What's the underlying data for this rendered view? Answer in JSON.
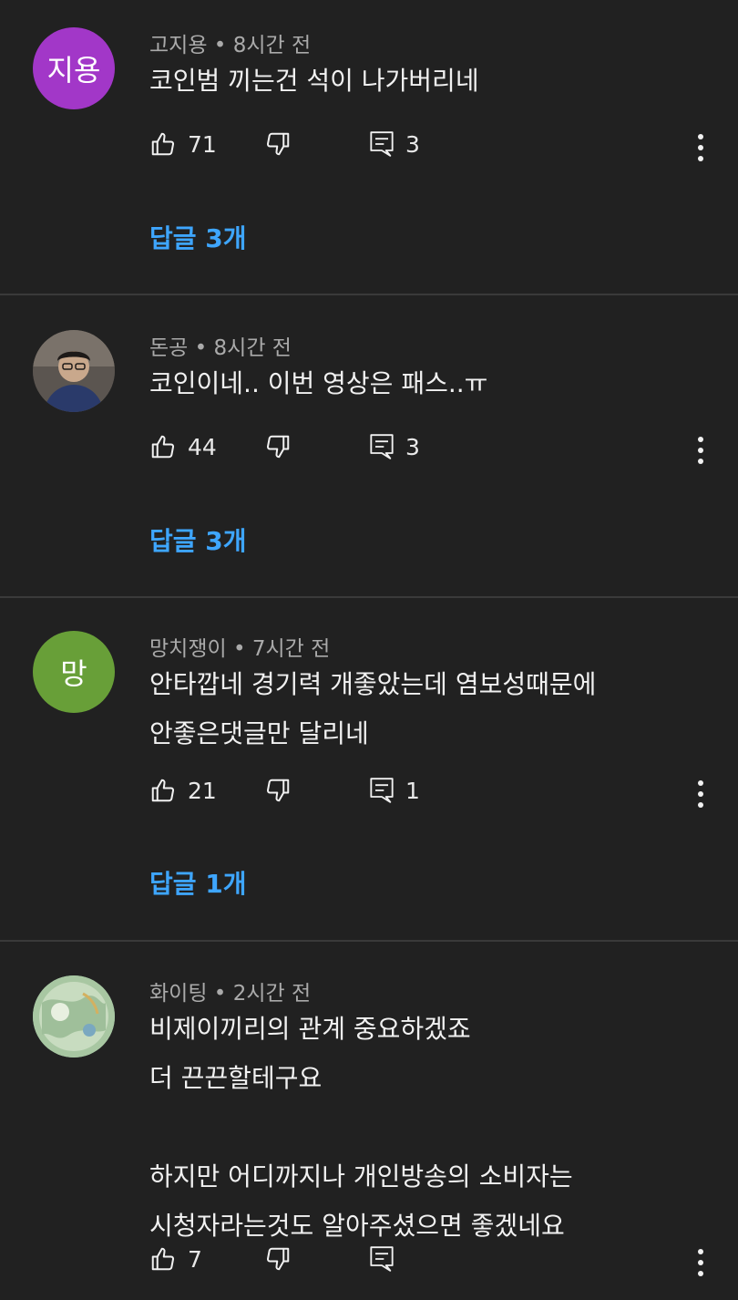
{
  "comments": [
    {
      "author": "고지용",
      "time": "8시간 전",
      "avatar_text": "지용",
      "avatar_color": "#a237c8",
      "text": "코인범 끼는건 석이 나가버리네",
      "likes": "71",
      "reply_count": "3",
      "replies_label": "답글 3개"
    },
    {
      "author": "돈공",
      "time": "8시간 전",
      "avatar_text": "",
      "avatar_color": "#4a4540",
      "text": "코인이네.. 이번 영상은 패스..ㅠ",
      "likes": "44",
      "reply_count": "3",
      "replies_label": "답글 3개"
    },
    {
      "author": "망치쟁이",
      "time": "7시간 전",
      "avatar_text": "망",
      "avatar_color": "#689f38",
      "text": "안타깝네 경기력 개좋았는데 염보성때문에\n안좋은댓글만 달리네",
      "likes": "21",
      "reply_count": "1",
      "replies_label": "답글 1개"
    },
    {
      "author": "화이팅",
      "time": "2시간 전",
      "avatar_text": "",
      "avatar_color": "#8ab59a",
      "text": "비제이끼리의 관계 중요하겠죠\n더 끈끈할테구요\n\n하지만 어디까지나 개인방송의 소비자는\n시청자라는것도 알아주셨으면 좋겠네요",
      "likes": "7",
      "reply_count": "",
      "replies_label": ""
    }
  ],
  "meta_separator": "•"
}
